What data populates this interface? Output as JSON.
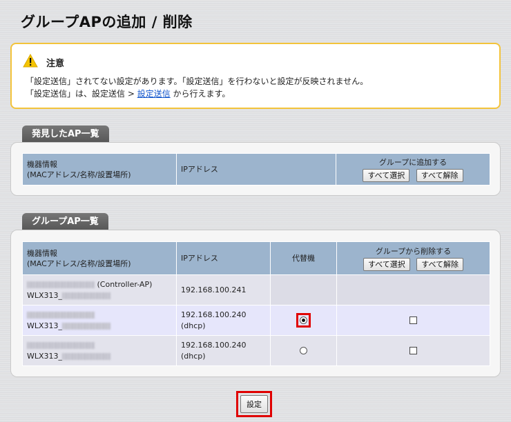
{
  "page": {
    "title": "グループAPの追加 / 削除"
  },
  "notice": {
    "title": "注意",
    "line1": "「設定送信」されてない設定があります。「設定送信」を行わないと設定が反映されません。",
    "line2_prefix": "「設定送信」は、設定送信 > ",
    "line2_link": "設定送信",
    "line2_suffix": " から行えます。"
  },
  "discovered": {
    "tab_label": "発見したAP一覧",
    "headers": {
      "device_line1": "機器情報",
      "device_line2": "(MACアドレス/名称/設置場所)",
      "ip": "IPアドレス",
      "add": "グループに追加する"
    },
    "select_all": "すべて選択",
    "deselect_all": "すべて解除"
  },
  "group": {
    "tab_label": "グループAP一覧",
    "headers": {
      "device_line1": "機器情報",
      "device_line2": "(MACアドレス/名称/設置場所)",
      "ip": "IPアドレス",
      "substitute": "代替機",
      "remove": "グループから削除する"
    },
    "select_all": "すべて選択",
    "deselect_all": "すべて解除",
    "rows": [
      {
        "device_suffix": "(Controller-AP)",
        "name_prefix": "WLX313_",
        "ip": "192.168.100.241",
        "ip_note": "",
        "substitute": "none",
        "removable": false
      },
      {
        "device_suffix": "",
        "name_prefix": "WLX313_",
        "ip": "192.168.100.240",
        "ip_note": "(dhcp)",
        "substitute": "checked",
        "removable": true
      },
      {
        "device_suffix": "",
        "name_prefix": "WLX313_",
        "ip": "192.168.100.240",
        "ip_note": "(dhcp)",
        "substitute": "unchecked",
        "removable": true
      }
    ]
  },
  "actions": {
    "save_label": "設定"
  },
  "colors": {
    "header_bg": "#9cb4cd",
    "highlight": "#e00000",
    "notice_border": "#f3c33a"
  }
}
